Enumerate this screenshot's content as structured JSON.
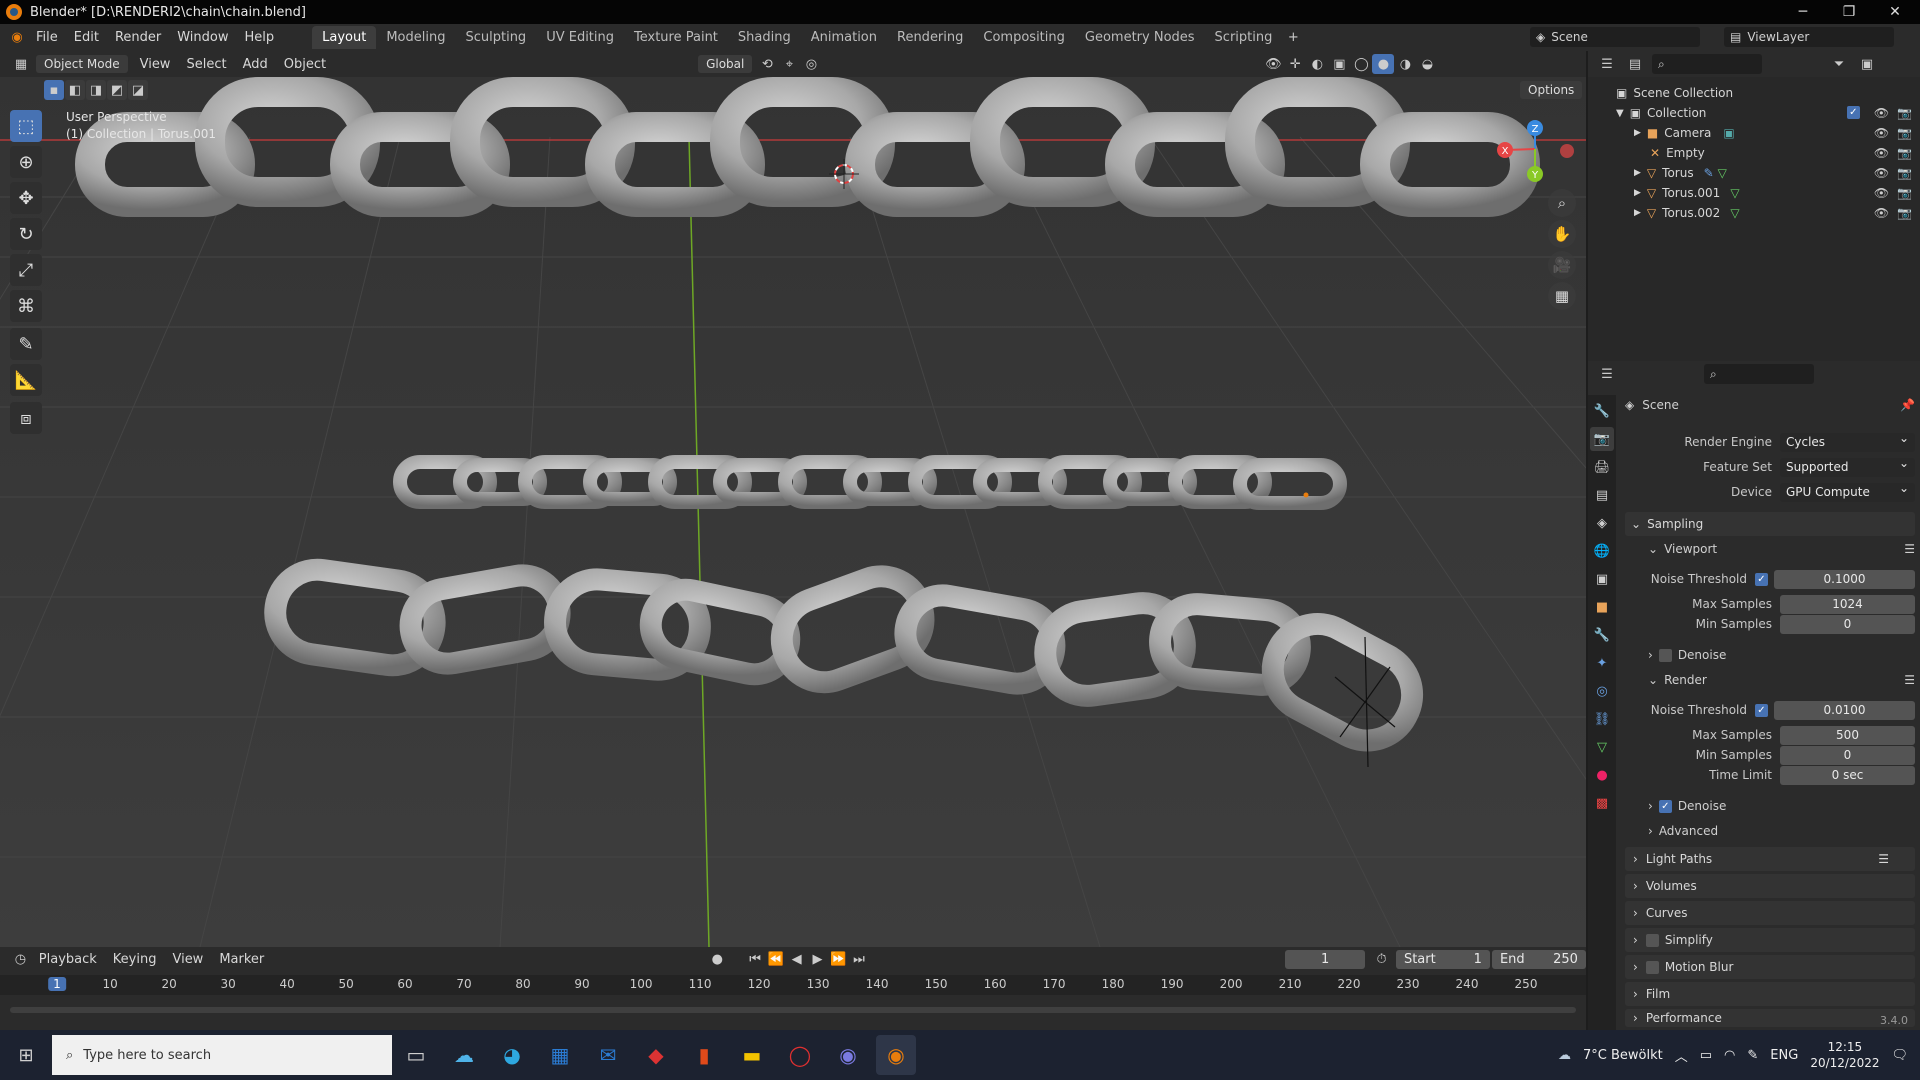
{
  "window": {
    "title": "Blender* [D:\\RENDERI2\\chain\\chain.blend]"
  },
  "menu": [
    "File",
    "Edit",
    "Render",
    "Window",
    "Help"
  ],
  "workspaces": [
    "Layout",
    "Modeling",
    "Sculpting",
    "UV Editing",
    "Texture Paint",
    "Shading",
    "Animation",
    "Rendering",
    "Compositing",
    "Geometry Nodes",
    "Scripting"
  ],
  "active_workspace": "Layout",
  "scene_name": "Scene",
  "view_layer": "ViewLayer",
  "viewport_header": {
    "mode": "Object Mode",
    "menus": [
      "View",
      "Select",
      "Add",
      "Object"
    ],
    "orientation": "Global",
    "options": "Options"
  },
  "viewport": {
    "line1": "User Perspective",
    "line2": "(1) Collection | Torus.001"
  },
  "gizmo": {
    "x": "X",
    "y": "Y",
    "z": "Z"
  },
  "outliner": {
    "root": "Scene Collection",
    "collection": "Collection",
    "items": [
      "Camera",
      "Empty",
      "Torus",
      "Torus.001",
      "Torus.002"
    ]
  },
  "properties": {
    "context": "Scene",
    "render_engine_label": "Render Engine",
    "render_engine": "Cycles",
    "feature_set_label": "Feature Set",
    "feature_set": "Supported",
    "device_label": "Device",
    "device": "GPU Compute",
    "sampling": "Sampling",
    "viewport": "Viewport",
    "render": "Render",
    "noise_threshold_label": "Noise Threshold",
    "max_samples_label": "Max Samples",
    "min_samples_label": "Min Samples",
    "time_limit_label": "Time Limit",
    "vp_noise_threshold": "0.1000",
    "vp_max_samples": "1024",
    "vp_min_samples": "0",
    "denoise": "Denoise",
    "r_noise_threshold": "0.0100",
    "r_max_samples": "500",
    "r_min_samples": "0",
    "r_time_limit": "0 sec",
    "advanced": "Advanced",
    "panels": [
      "Light Paths",
      "Volumes",
      "Curves",
      "Simplify",
      "Motion Blur",
      "Film",
      "Performance"
    ]
  },
  "timeline": {
    "menus": [
      "Playback",
      "Keying",
      "View",
      "Marker"
    ],
    "current_frame": "1",
    "start_label": "Start",
    "start": "1",
    "end_label": "End",
    "end": "250",
    "ticks": [
      "1",
      "10",
      "20",
      "30",
      "40",
      "50",
      "60",
      "70",
      "80",
      "90",
      "100",
      "110",
      "120",
      "130",
      "140",
      "150",
      "160",
      "170",
      "180",
      "190",
      "200",
      "210",
      "220",
      "230",
      "240",
      "250"
    ]
  },
  "version": "3.4.0",
  "taskbar": {
    "search": "Type here to search",
    "weather": "7°C  Bewölkt",
    "lang": "ENG",
    "time": "12:15",
    "date": "20/12/2022"
  },
  "colors": {
    "accent": "#4772b3",
    "orange": "#e87d0d",
    "x_axis": "#e64545",
    "y_axis": "#8ac926",
    "z_axis": "#3a8be0"
  }
}
